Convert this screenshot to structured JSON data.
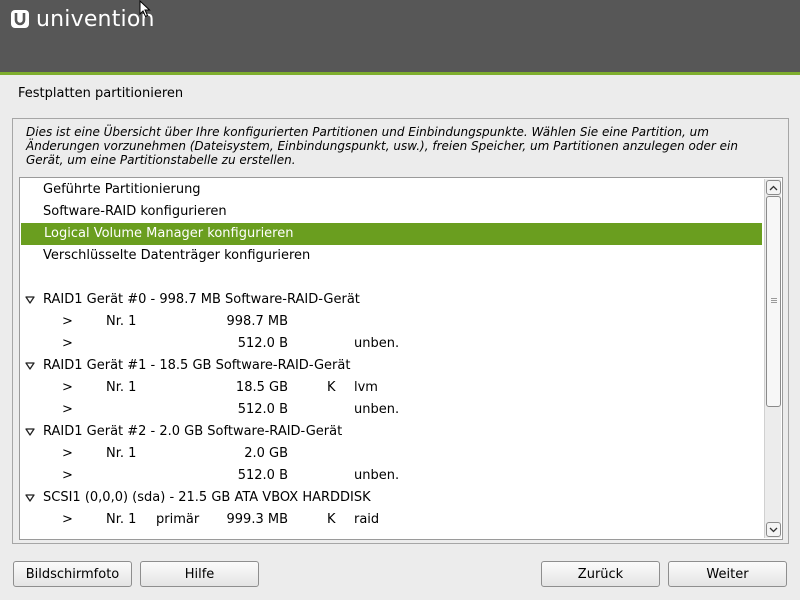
{
  "banner": {
    "logo_text": "univention",
    "accent_color": "#7fae2e",
    "bg_color": "#575757"
  },
  "page_title": "Festplatten partitionieren",
  "description": "Dies ist eine Übersicht über Ihre konfigurierten Partitionen und Einbindungspunkte. Wählen Sie eine Partition, um Änderungen vorzunehmen (Dateisystem, Einbindungspunkt, usw.), freien Speicher, um Partitionen anzulegen oder ein Gerät, um eine Partitionstabelle zu erstellen.",
  "menu_items": [
    "Geführte Partitionierung",
    "Software-RAID konfigurieren",
    "Logical Volume Manager konfigurieren",
    "Verschlüsselte Datenträger konfigurieren"
  ],
  "devices": [
    {
      "label": "RAID1 Gerät #0 - 998.7 MB Software-RAID-Gerät",
      "partitions": [
        {
          "arrow": ">",
          "nr": "Nr. 1",
          "type": "",
          "size": "998.7 MB",
          "flag": "",
          "fs": ""
        },
        {
          "arrow": ">",
          "nr": "",
          "type": "",
          "size": "512.0 B",
          "flag": "",
          "fs": "unben."
        }
      ]
    },
    {
      "label": "RAID1 Gerät #1 - 18.5 GB Software-RAID-Gerät",
      "partitions": [
        {
          "arrow": ">",
          "nr": "Nr. 1",
          "type": "",
          "size": "18.5 GB",
          "flag": "K",
          "fs": "lvm"
        },
        {
          "arrow": ">",
          "nr": "",
          "type": "",
          "size": "512.0 B",
          "flag": "",
          "fs": "unben."
        }
      ]
    },
    {
      "label": "RAID1 Gerät #2 - 2.0 GB Software-RAID-Gerät",
      "partitions": [
        {
          "arrow": ">",
          "nr": "Nr. 1",
          "type": "",
          "size": "2.0 GB",
          "flag": "",
          "fs": ""
        },
        {
          "arrow": ">",
          "nr": "",
          "type": "",
          "size": "512.0 B",
          "flag": "",
          "fs": "unben."
        }
      ]
    },
    {
      "label": "SCSI1 (0,0,0) (sda) - 21.5 GB ATA VBOX HARDDISK",
      "partitions": [
        {
          "arrow": ">",
          "nr": "Nr. 1",
          "type": "primär",
          "size": "999.3 MB",
          "flag": "K",
          "fs": "raid"
        }
      ]
    }
  ],
  "selected_index": 2,
  "buttons": {
    "screenshot": "Bildschirmfoto",
    "help": "Hilfe",
    "back": "Zurück",
    "next": "Weiter"
  },
  "selection_color": "#6a9e1f"
}
